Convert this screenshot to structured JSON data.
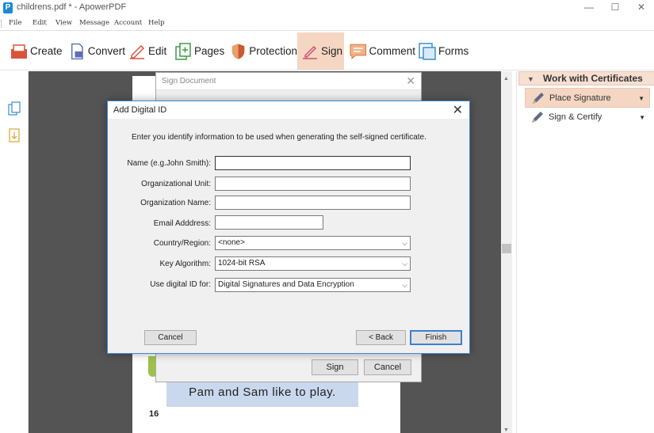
{
  "window": {
    "title": "childrens.pdf * - ApowerPDF",
    "logo_letter": "P",
    "minimize": "—",
    "maximize": "☐",
    "close": "✕"
  },
  "menu": [
    "File",
    "Edit",
    "View",
    "Message",
    "Account",
    "Help"
  ],
  "toolbar": {
    "create": "Create",
    "convert": "Convert",
    "edit": "Edit",
    "pages": "Pages",
    "protection": "Protection",
    "sign": "Sign",
    "comment": "Comment",
    "forms": "Forms",
    "active": "Sign"
  },
  "document": {
    "caption": "Pam and Sam like to play.",
    "page_number": "16"
  },
  "right_panel": {
    "header": "Work with Certificates",
    "items": [
      {
        "label": "Place Signature",
        "active": true
      },
      {
        "label": "Sign & Certify",
        "active": false
      }
    ]
  },
  "sign_dialog": {
    "title": "Sign Document",
    "sign_button": "Sign",
    "cancel_button": "Cancel"
  },
  "digital_id_dialog": {
    "title": "Add Digital ID",
    "intro": "Enter you identify information to be used when generating the self-signed certificate.",
    "fields": {
      "name": {
        "label": "Name (e.g.John Smith):",
        "value": ""
      },
      "org_unit": {
        "label": "Organizational Unit:",
        "value": ""
      },
      "org_name": {
        "label": "Organization Name:",
        "value": ""
      },
      "email": {
        "label": "Email Adddress:",
        "value": ""
      },
      "country": {
        "label": "Country/Region:",
        "value": "<none>"
      },
      "key_algorithm": {
        "label": "Key Algorithm:",
        "value": "1024-bit RSA"
      },
      "use_for": {
        "label": "Use digital ID for:",
        "value": "Digital Signatures and Data Encryption"
      }
    },
    "buttons": {
      "cancel": "Cancel",
      "back": "< Back",
      "finish": "Finish"
    }
  },
  "colors": {
    "accent": "#f5d6c3",
    "dialog_border": "#3b8ad8",
    "doc_background": "#545454",
    "caption_bg": "#c9d8ed"
  }
}
